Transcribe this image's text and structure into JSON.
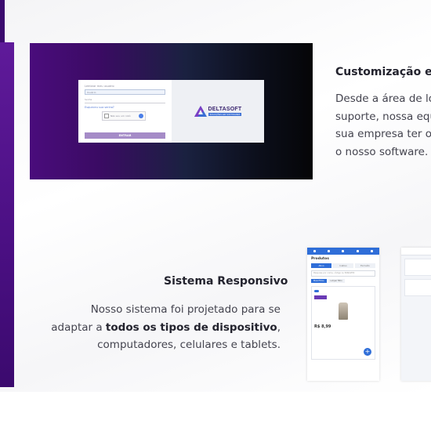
{
  "customization": {
    "title": "Customização e",
    "lines": [
      "Desde a área de lo",
      "suporte, nossa equ",
      "sua empresa ter o",
      "o nosso software."
    ]
  },
  "responsive": {
    "title": "Sistema Responsivo",
    "line1": "Nosso sistema foi projetado para se",
    "line2_prefix": "adaptar a ",
    "line2_bold": "todos os tipos de dispositivo",
    "line2_suffix": ",",
    "line3": "computadores, celulares e tablets."
  },
  "login_mock": {
    "remember": "Lembrar meu usuário",
    "user_field": "Usuário",
    "password_field": "Senha",
    "forgot": "Esqueceu sua senha?",
    "captcha": "Não sou um robô",
    "button": "ENTRAR",
    "logo_name": "DELTASOFT",
    "logo_tag": "SOLUÇÕES EM SOFTWARES"
  },
  "phone_mock": {
    "title": "Produtos",
    "tabs": [
      "Ativo",
      "Inativo",
      "Excluído"
    ],
    "search": "Pesquise por nome, código ou EAN/GTIN",
    "chips": [
      "Mais filtros",
      "Limpar filtro"
    ],
    "price": "R$ 8,99"
  },
  "colors": {
    "accent_purple": "#5f1a9a",
    "brand_blue": "#2f6ed8",
    "text_dark": "#23232e"
  }
}
